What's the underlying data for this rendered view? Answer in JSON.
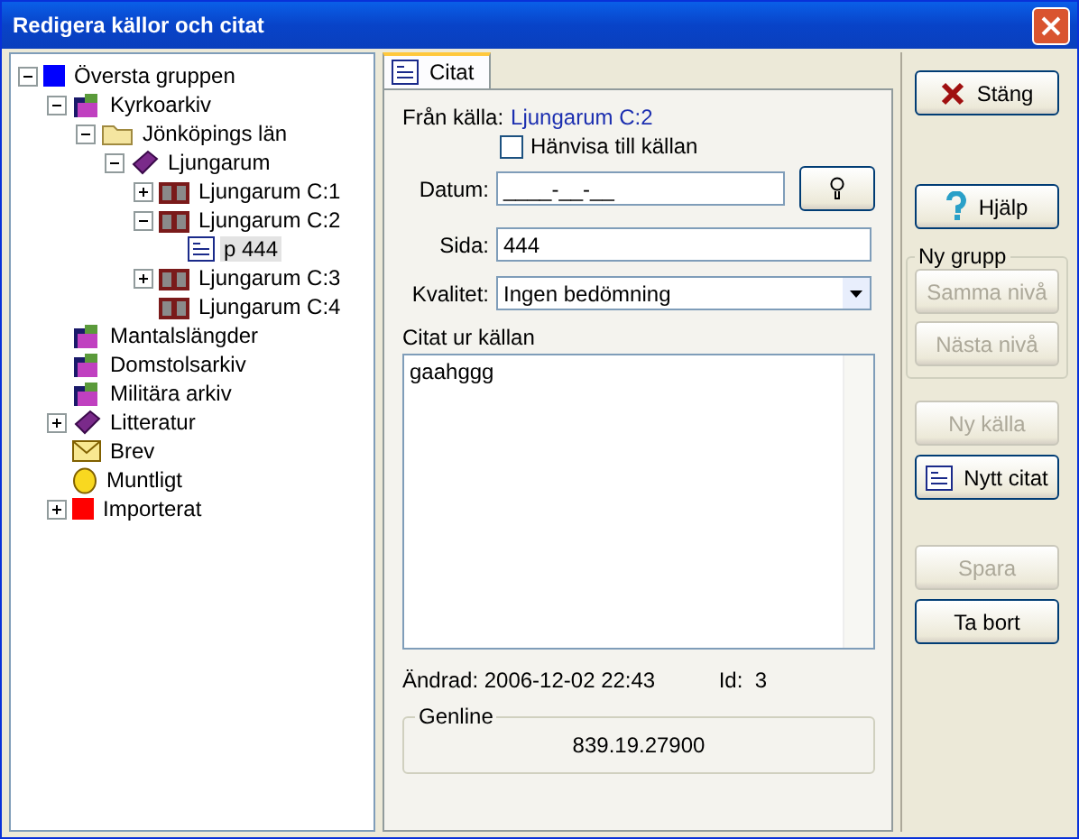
{
  "window": {
    "title": "Redigera källor och citat"
  },
  "tree": [
    {
      "label": "Översta gruppen",
      "kind": "group-blue",
      "expanded": true,
      "selected": false,
      "children": [
        {
          "label": "Kyrkoarkiv",
          "kind": "archive",
          "expanded": true,
          "selected": false,
          "children": [
            {
              "label": "Jönköpings län",
              "kind": "folder",
              "expanded": true,
              "selected": false,
              "children": [
                {
                  "label": "Ljungarum",
                  "kind": "book",
                  "expanded": true,
                  "selected": false,
                  "children": [
                    {
                      "label": "Ljungarum C:1",
                      "kind": "source",
                      "expanded": false,
                      "selected": false
                    },
                    {
                      "label": "Ljungarum C:2",
                      "kind": "source",
                      "expanded": true,
                      "selected": false,
                      "children": [
                        {
                          "label": "p 444",
                          "kind": "citation",
                          "selected": true
                        }
                      ]
                    },
                    {
                      "label": "Ljungarum C:3",
                      "kind": "source",
                      "expanded": false,
                      "selected": false
                    },
                    {
                      "label": "Ljungarum C:4",
                      "kind": "source",
                      "selected": false
                    }
                  ]
                }
              ]
            }
          ]
        },
        {
          "label": "Mantalslängder",
          "kind": "archive",
          "selected": false
        },
        {
          "label": "Domstolsarkiv",
          "kind": "archive",
          "selected": false
        },
        {
          "label": "Militära arkiv",
          "kind": "archive",
          "selected": false
        },
        {
          "label": "Litteratur",
          "kind": "book",
          "expanded": false,
          "selected": false
        },
        {
          "label": "Brev",
          "kind": "letter",
          "selected": false
        },
        {
          "label": "Muntligt",
          "kind": "face",
          "selected": false
        },
        {
          "label": "Importerat",
          "kind": "group-red",
          "expanded": false,
          "selected": false
        }
      ]
    }
  ],
  "tab": {
    "label": "Citat",
    "selected": true
  },
  "form": {
    "from_label": "Från källa:",
    "from_value": "Ljungarum C:2",
    "refer": {
      "label": "Hänvisa till källan",
      "checked": false
    },
    "date": {
      "label": "Datum:",
      "value": "____-__-__"
    },
    "page": {
      "label": "Sida:",
      "value": "444"
    },
    "quality": {
      "label": "Kvalitet:",
      "value": "Ingen bedömning"
    },
    "quote": {
      "label": "Citat ur källan",
      "value": "gaahggg"
    },
    "changed": "Ändrad: 2006-12-02 22:43",
    "id": "Id:  3",
    "genline": {
      "title": "Genline",
      "value": "839.19.27900"
    }
  },
  "buttons": [
    {
      "label": "Stäng",
      "kind": "close",
      "disabled": false
    },
    {
      "label": "Hjälp",
      "kind": "help",
      "disabled": false
    }
  ],
  "group": {
    "title": "Ny grupp",
    "buttons": [
      {
        "label": "Samma nivå",
        "disabled": true
      },
      {
        "label": "Nästa nivå",
        "disabled": true
      }
    ]
  },
  "buttons2": [
    {
      "label": "Ny källa",
      "kind": "plain",
      "disabled": true
    },
    {
      "label": "Nytt citat",
      "kind": "citation",
      "disabled": false
    }
  ],
  "buttons3": [
    {
      "label": "Spara",
      "disabled": true
    },
    {
      "label": "Ta bort",
      "disabled": false
    }
  ]
}
